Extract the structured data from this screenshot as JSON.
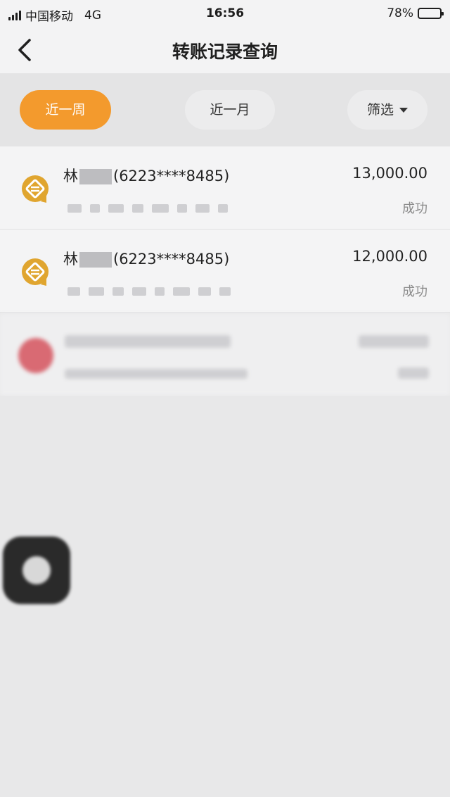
{
  "status_bar": {
    "carrier": "中国移动",
    "network": "4G",
    "time": "16:56",
    "battery": "78%"
  },
  "nav": {
    "title": "转账记录查询"
  },
  "filters": {
    "week": "近一周",
    "month": "近一月",
    "filter": "筛选"
  },
  "records": [
    {
      "name_prefix": "林",
      "account": "(6223****8485)",
      "amount": "13,000.00",
      "status": "成功"
    },
    {
      "name_prefix": "林",
      "account": "(6223****8485)",
      "amount": "12,000.00",
      "status": "成功"
    }
  ],
  "colors": {
    "accent": "#f39a2d",
    "icon": "#e0a52f"
  }
}
